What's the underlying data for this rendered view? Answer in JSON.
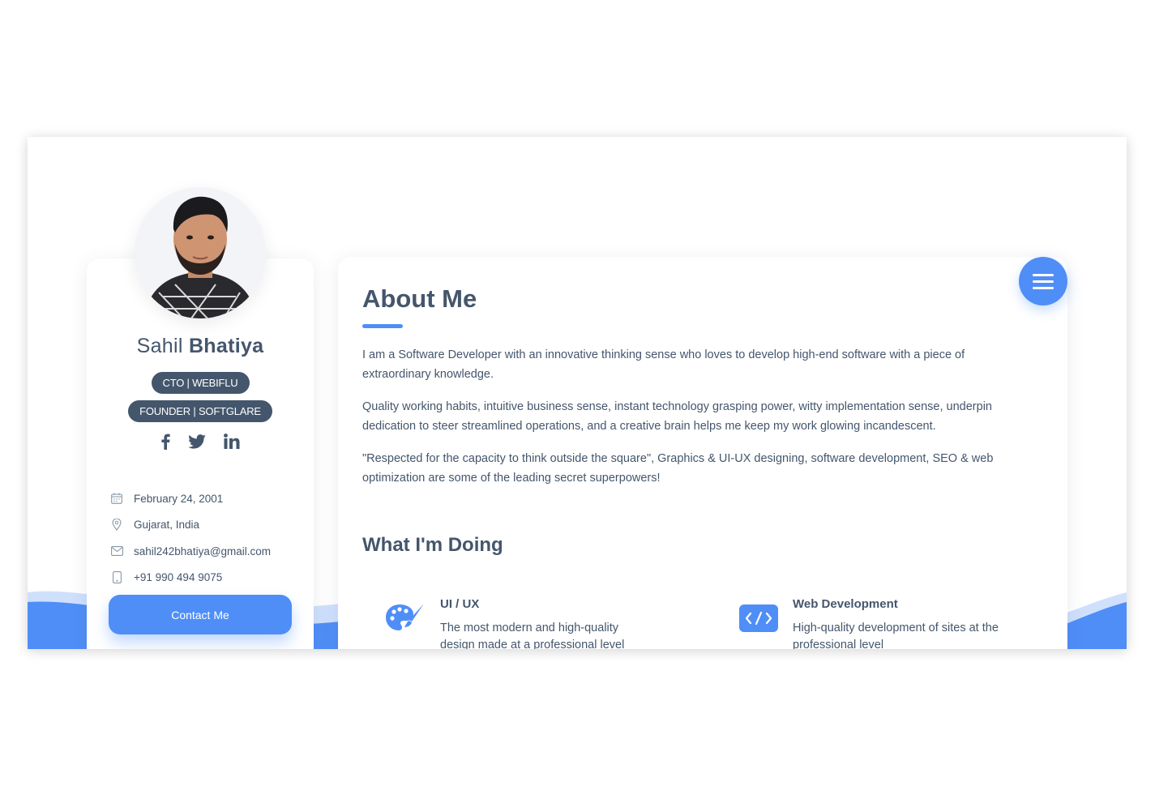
{
  "profile": {
    "first_name": "Sahil",
    "last_name": "Bhatiya",
    "badges": [
      "CTO | WEBIFLU",
      "FOUNDER | SOFTGLARE"
    ],
    "socials": [
      "facebook-icon",
      "twitter-icon",
      "linkedin-icon"
    ],
    "info": {
      "birthday": "February 24, 2001",
      "location": "Gujarat, India",
      "email": "sahil242bhatiya@gmail.com",
      "phone": "+91 990 494 9075"
    },
    "contact_label": "Contact Me"
  },
  "about": {
    "title": "About Me",
    "paragraphs": [
      "I am a Software Developer with an innovative thinking sense who loves to develop high-end software with a piece of extraordinary knowledge.",
      "Quality working habits, intuitive business sense, instant technology grasping power, witty implementation sense, underpin dedication to steer streamlined operations, and a creative brain helps me keep my work glowing incandescent.",
      "\"Respected for the capacity to think outside the square\", Graphics & UI-UX designing, software development, SEO & web optimization are some of the leading secret superpowers!"
    ]
  },
  "doing": {
    "title": "What I'm Doing",
    "services": [
      {
        "title": "UI / UX",
        "description": "The most modern and high-quality design made at a professional level",
        "icon": "palette-icon"
      },
      {
        "title": "Web Development",
        "description": "High-quality development of sites at the professional level",
        "icon": "code-icon"
      }
    ]
  },
  "colors": {
    "accent": "#4f8ef7",
    "text": "#44566c"
  }
}
